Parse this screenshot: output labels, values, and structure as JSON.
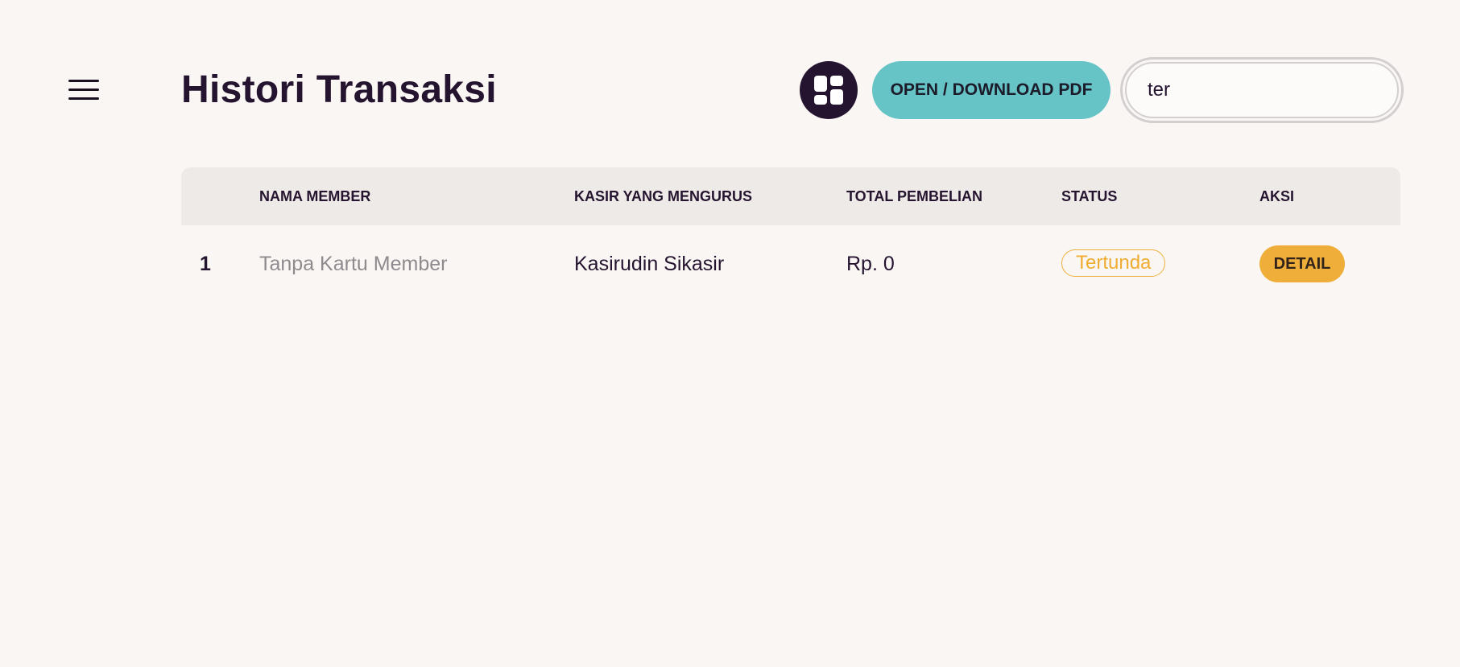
{
  "header": {
    "title": "Histori Transaksi",
    "menu_icon": "hamburger-menu-icon",
    "layout_icon": "dashboard-grid-icon",
    "pdf_button_label": "OPEN / DOWNLOAD PDF",
    "search_value": "ter"
  },
  "table": {
    "columns": {
      "member": "NAMA MEMBER",
      "kasir": "KASIR YANG MENGURUS",
      "total": "TOTAL PEMBELIAN",
      "status": "STATUS",
      "aksi": "AKSI"
    },
    "rows": [
      {
        "no": "1",
        "member": "Tanpa Kartu Member",
        "kasir": "Kasirudin Sikasir",
        "total": "Rp. 0",
        "status": "Tertunda",
        "action_label": "DETAIL"
      }
    ]
  },
  "colors": {
    "background": "#faf6f4",
    "primary_dark": "#25142f",
    "pdf_button": "#66c3c6",
    "status_pending": "#efad32",
    "detail_button": "#efae3a",
    "table_header": "#eeeae7"
  }
}
